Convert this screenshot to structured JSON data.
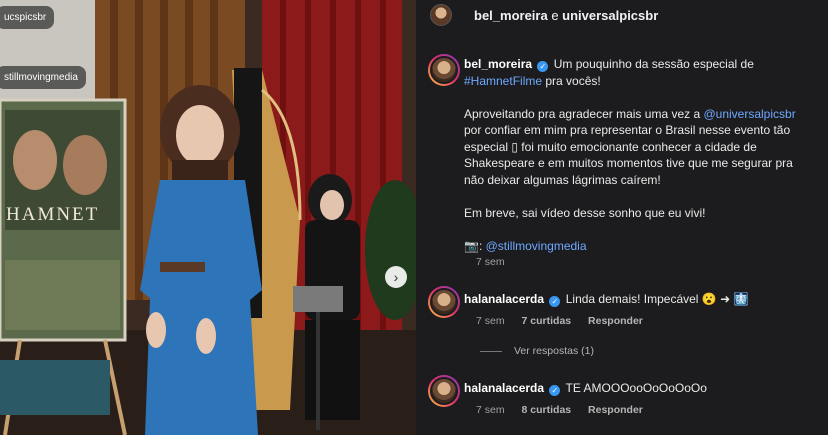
{
  "header": {
    "user1": "bel_moreira",
    "sep": " e ",
    "user2": "universalpicsbr"
  },
  "photo_tags": {
    "tag1": "ucspicsbr",
    "tag2": "stillmovingmedia"
  },
  "poster": {
    "title": "HAMNET"
  },
  "caption": {
    "username": "bel_moreira",
    "line1": "Um pouquinho da sessão especial de",
    "hashtag": "#HamnetFilme",
    "line1b": " pra vocês!",
    "p2a": "Aproveitando pra agradecer mais uma vez a ",
    "mention1": "@universalpicsbr",
    "p2b": " por confiar em mim pra representar o Brasil nesse evento tão especial ▯ foi muito emocionante conhecer a cidade de Shakespeare e em muitos momentos tive que me segurar pra não deixar algumas lágrimas caírem!",
    "p3": "Em breve, sai vídeo desse sonho que eu vivi!",
    "camera": "📷:",
    "mention2": "@stillmovingmedia",
    "time": "7 sem"
  },
  "comments": [
    {
      "username": "halanalacerda",
      "text": "Linda demais! Impecável 😮 ➜ 🩻",
      "time": "7 sem",
      "likes": "7 curtidas",
      "reply": "Responder"
    },
    {
      "username": "halanalacerda",
      "text": "TE AMOOOooOoOoOoOo",
      "time": "7 sem",
      "likes": "8 curtidas",
      "reply": "Responder"
    }
  ],
  "view_replies": "Ver respostas (1)",
  "icons": {
    "verified": "verified-badge-icon",
    "next": "chevron-right-icon"
  }
}
